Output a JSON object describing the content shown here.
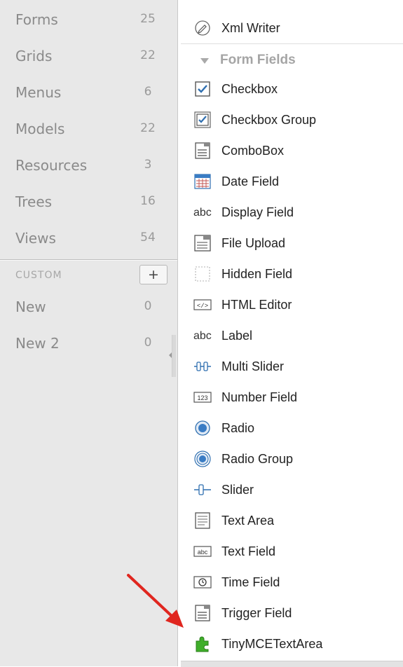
{
  "sidebar": {
    "items": [
      {
        "label": "Forms",
        "count": "25"
      },
      {
        "label": "Grids",
        "count": "22"
      },
      {
        "label": "Menus",
        "count": "6"
      },
      {
        "label": "Models",
        "count": "22"
      },
      {
        "label": "Resources",
        "count": "3"
      },
      {
        "label": "Trees",
        "count": "16"
      },
      {
        "label": "Views",
        "count": "54"
      }
    ],
    "custom_header": "CUSTOM",
    "add_label": "+",
    "custom_items": [
      {
        "label": "New",
        "count": "0"
      },
      {
        "label": "New 2",
        "count": "0"
      }
    ]
  },
  "toolbox": {
    "top_item": {
      "label": "Xml Writer",
      "icon": "xml-writer-icon"
    },
    "group_header": "Form Fields",
    "items": [
      {
        "label": "Checkbox",
        "icon": "checkbox-icon"
      },
      {
        "label": "Checkbox Group",
        "icon": "checkbox-group-icon"
      },
      {
        "label": "ComboBox",
        "icon": "combobox-icon"
      },
      {
        "label": "Date Field",
        "icon": "calendar-icon"
      },
      {
        "label": "Display Field",
        "icon": "abc-text-icon",
        "icon_text": "abc"
      },
      {
        "label": "File Upload",
        "icon": "file-upload-icon"
      },
      {
        "label": "Hidden Field",
        "icon": "hidden-field-icon"
      },
      {
        "label": "HTML Editor",
        "icon": "html-editor-icon",
        "icon_text": "</>"
      },
      {
        "label": "Label",
        "icon": "abc-text-icon",
        "icon_text": "abc"
      },
      {
        "label": "Multi Slider",
        "icon": "multi-slider-icon"
      },
      {
        "label": "Number Field",
        "icon": "number-field-icon",
        "icon_text": "123"
      },
      {
        "label": "Radio",
        "icon": "radio-icon"
      },
      {
        "label": "Radio Group",
        "icon": "radio-group-icon"
      },
      {
        "label": "Slider",
        "icon": "slider-icon"
      },
      {
        "label": "Text Area",
        "icon": "text-area-icon"
      },
      {
        "label": "Text Field",
        "icon": "text-field-icon",
        "icon_text": "abc"
      },
      {
        "label": "Time Field",
        "icon": "clock-icon"
      },
      {
        "label": "Trigger Field",
        "icon": "trigger-field-icon"
      },
      {
        "label": "TinyMCETextArea",
        "icon": "puzzle-plugin-icon"
      }
    ]
  },
  "colors": {
    "sidebar_bg": "#e8e8e8",
    "annotation_arrow": "#e0261f",
    "icon_blue": "#2f6fb0",
    "plugin_green": "#3fae2a"
  }
}
